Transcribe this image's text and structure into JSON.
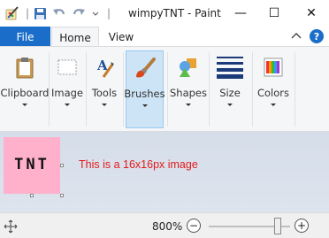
{
  "window": {
    "title": "wimpyTNT - Paint",
    "buttons": {
      "minimize": "—",
      "maximize": "☐",
      "close": "✕"
    }
  },
  "quick_access": {
    "icons": [
      "paint-app-icon",
      "save-icon",
      "undo-icon",
      "redo-icon",
      "customize-dropdown-icon"
    ]
  },
  "tabs": {
    "file": "File",
    "home": "Home",
    "view": "View",
    "active": "Home"
  },
  "ribbon": {
    "help": "?",
    "groups": {
      "clipboard": "Clipboard",
      "image": "Image",
      "tools": "Tools",
      "brushes": "Brushes",
      "shapes": "Shapes",
      "size": "Size",
      "colors": "Colors"
    }
  },
  "canvas": {
    "image_text": "TNT",
    "annotation": "This is a 16x16px image",
    "image_color": "#ffb1cb",
    "annotation_color": "#e61a1a"
  },
  "status": {
    "zoom": "800%",
    "zoom_out": "−",
    "zoom_in": "+",
    "zoom_slider_fraction": 0.85
  },
  "colors": {
    "accent": "#1a6ec9",
    "selected_group": "#cde4f7"
  }
}
